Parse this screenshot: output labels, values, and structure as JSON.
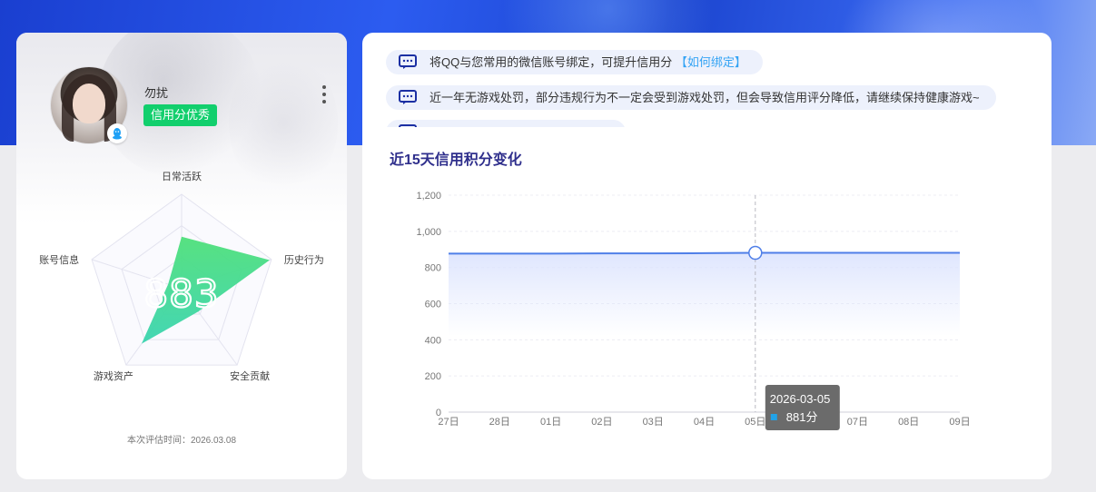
{
  "profile": {
    "nickname": "勿扰",
    "credit_level": "信用分优秀",
    "score": "883",
    "eval_time": "本次评估时间：2026.03.08"
  },
  "radar": {
    "axes": [
      "日常活跃",
      "历史行为",
      "安全贡献",
      "游戏资产",
      "账号信息"
    ],
    "values": [
      0.55,
      0.98,
      0.3,
      0.72,
      0.15
    ]
  },
  "notices": [
    {
      "text": "将QQ与您常用的微信账号绑定，可提升信用分",
      "link": "【如何绑定】"
    },
    {
      "text": "近一年无游戏处罚，部分违规行为不一定会受到游戏处罚，但会导致信用评分降低，请继续保持健康游戏~",
      "link": ""
    }
  ],
  "chart_title": "近15天信用积分变化",
  "chart_data": {
    "type": "area",
    "x": [
      "27日",
      "28日",
      "01日",
      "02日",
      "03日",
      "04日",
      "05日",
      "06日",
      "07日",
      "08日",
      "09日"
    ],
    "y_ticks": [
      "0",
      "200",
      "400",
      "600",
      "800",
      "1,000",
      "1,200"
    ],
    "values": [
      877,
      877,
      877,
      878,
      878,
      879,
      881,
      881,
      881,
      881,
      881
    ],
    "ylim": [
      0,
      1200
    ],
    "line_color": "#4f7fe8",
    "fill_color": "#dfe6fe",
    "tooltip": {
      "date": "2026-03-05",
      "value": "881分",
      "index": 6
    }
  }
}
